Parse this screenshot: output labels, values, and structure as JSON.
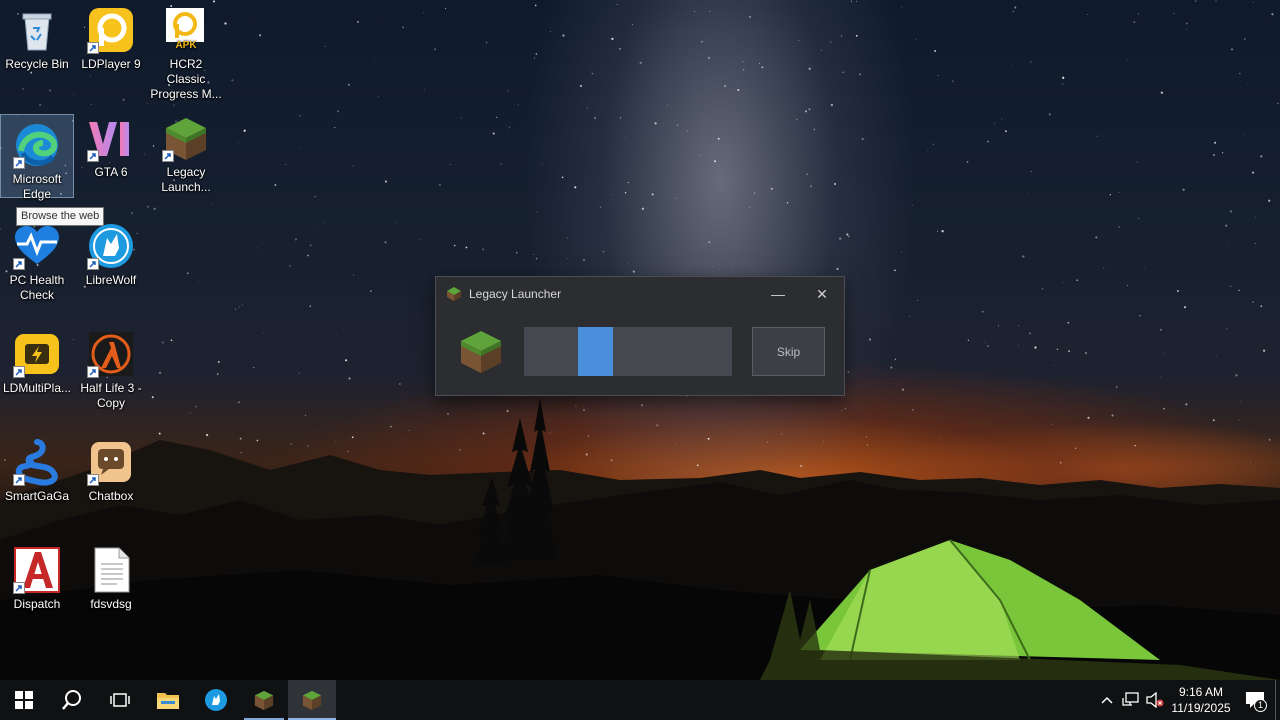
{
  "desktop": {
    "icons": [
      {
        "label": "Recycle Bin",
        "icon": "recycle-bin-icon"
      },
      {
        "label": "LDPlayer 9",
        "icon": "ldplayer-icon"
      },
      {
        "label": "HCR2 Classic Progress M...",
        "icon": "apk-icon",
        "badge": "APK"
      },
      {
        "label": "Microsoft Edge",
        "icon": "edge-icon"
      },
      {
        "label": "GTA 6",
        "icon": "gta6-icon"
      },
      {
        "label": "Legacy Launch...",
        "icon": "grass-block-icon"
      },
      {
        "label": "PC Health Check",
        "icon": "health-check-icon"
      },
      {
        "label": "LibreWolf",
        "icon": "librewolf-icon"
      },
      {
        "label": "LDMultiPla...",
        "icon": "ldmultiplayer-icon"
      },
      {
        "label": "Half Life 3 - Copy",
        "icon": "half-life-icon"
      },
      {
        "label": "SmartGaGa",
        "icon": "smartgaga-icon"
      },
      {
        "label": "Chatbox",
        "icon": "chatbox-icon"
      },
      {
        "label": "Dispatch",
        "icon": "dispatch-icon"
      },
      {
        "label": "fdsvdsg",
        "icon": "text-file-icon"
      }
    ],
    "tooltip": "Browse the web"
  },
  "launcher": {
    "title": "Legacy Launcher",
    "minimize_glyph": "—",
    "close_glyph": "✕",
    "skip_label": "Skip",
    "progress_indicator": {
      "start_fraction": 0.26,
      "width_fraction": 0.17,
      "mode": "indeterminate"
    }
  },
  "taskbar": {
    "items": [
      "start-icon",
      "search-icon",
      "task-view-icon",
      "file-explorer-icon",
      "librewolf-icon",
      "grass-block-icon",
      "grass-block-icon"
    ],
    "time": "9:16 AM",
    "date": "11/19/2025",
    "notification_count": "1"
  },
  "colors": {
    "accent": "#4a8fdb",
    "taskbar": "#0f1113",
    "window_bg": "#2b2d31"
  }
}
